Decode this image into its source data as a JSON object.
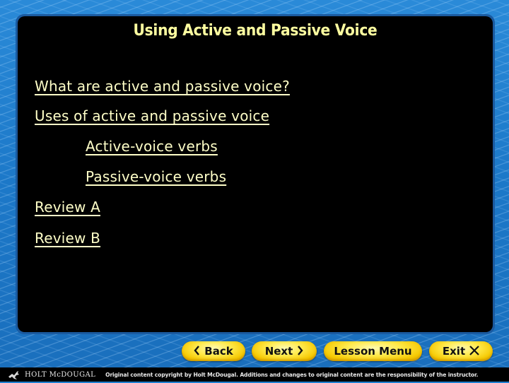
{
  "slide": {
    "title": "Using Active and Passive Voice",
    "links": [
      {
        "label": "What are active and passive voice?",
        "level": 1
      },
      {
        "label": "Uses of active and passive voice",
        "level": 1
      },
      {
        "label": "Active-voice verbs",
        "level": 2
      },
      {
        "label": "Passive-voice verbs",
        "level": 2
      },
      {
        "label": "Review A",
        "level": 1
      },
      {
        "label": "Review B",
        "level": 1
      }
    ]
  },
  "navigation": {
    "back": {
      "label": "Back",
      "icon": "chevron-left-icon",
      "glyph": "〈"
    },
    "next": {
      "label": "Next",
      "icon": "chevron-right-icon",
      "glyph": "〉"
    },
    "lesson_menu": {
      "label": "Lesson Menu"
    },
    "exit": {
      "label": "Exit",
      "icon": "close-icon",
      "glyph": "✕"
    }
  },
  "footer": {
    "brand": "HOLT McDOUGAL",
    "copyright": "Original content copyright by Holt McDougal. Additions and changes to original content are the responsibility of the instructor."
  },
  "colors": {
    "title": "#ffffa0",
    "link": "#ffffc8",
    "panel": "#000000",
    "background": "#1f7fd0",
    "button": "#ffe94a"
  }
}
